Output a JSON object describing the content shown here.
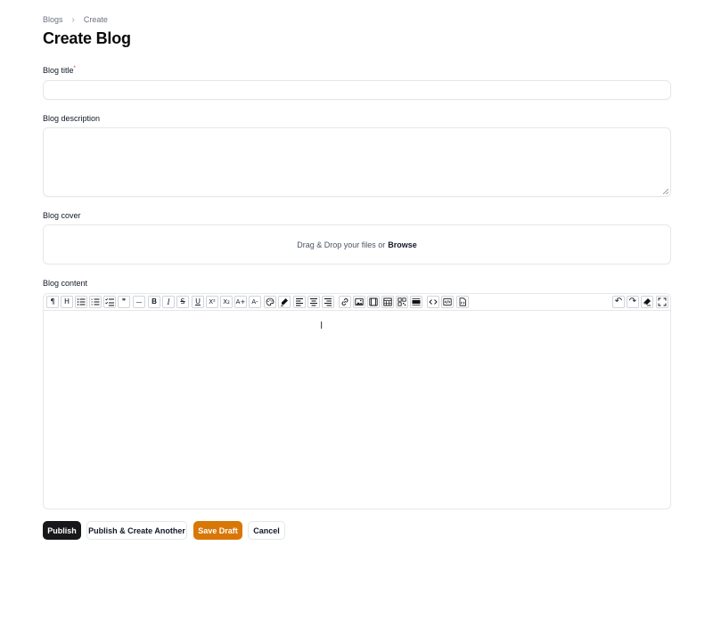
{
  "breadcrumb": {
    "parent": "Blogs",
    "separator": "›",
    "current": "Create"
  },
  "page_title": "Create Blog",
  "fields": {
    "title": {
      "label": "Blog title",
      "required_mark": "*",
      "value": ""
    },
    "description": {
      "label": "Blog description",
      "value": ""
    },
    "cover": {
      "label": "Blog cover",
      "drop_text": "Drag & Drop your files or",
      "browse_text": "Browse"
    },
    "content": {
      "label": "Blog content",
      "value": ""
    }
  },
  "toolbar": {
    "left": [
      {
        "name": "paragraph-icon",
        "glyph": "¶"
      },
      {
        "name": "heading-icon",
        "glyph": "H"
      },
      {
        "name": "bullet-list-icon",
        "glyph": ""
      },
      {
        "name": "ordered-list-icon",
        "glyph": ""
      },
      {
        "name": "checklist-icon",
        "glyph": ""
      },
      {
        "name": "blockquote-icon",
        "glyph": "❞"
      },
      {
        "name": "horizontal-rule-icon",
        "glyph": "—"
      },
      {
        "name": "bold-icon",
        "glyph": "B"
      },
      {
        "name": "italic-icon",
        "glyph": "I"
      },
      {
        "name": "strikethrough-icon",
        "glyph": "S"
      },
      {
        "name": "underline-icon",
        "glyph": "U"
      },
      {
        "name": "superscript-icon",
        "glyph": "X²"
      },
      {
        "name": "subscript-icon",
        "glyph": "X₂"
      },
      {
        "name": "font-size-increase-icon",
        "glyph": "A+"
      },
      {
        "name": "font-size-decrease-icon",
        "glyph": "A-"
      },
      {
        "name": "color-palette-icon",
        "glyph": ""
      },
      {
        "name": "highlighter-icon",
        "glyph": ""
      },
      {
        "name": "align-left-icon",
        "glyph": ""
      },
      {
        "name": "align-center-icon",
        "glyph": ""
      },
      {
        "name": "align-right-icon",
        "glyph": ""
      },
      {
        "name": "link-icon",
        "glyph": ""
      },
      {
        "name": "image-icon",
        "glyph": ""
      },
      {
        "name": "video-icon",
        "glyph": ""
      },
      {
        "name": "table-icon",
        "glyph": ""
      },
      {
        "name": "grid-icon",
        "glyph": ""
      },
      {
        "name": "block-icon",
        "glyph": ""
      },
      {
        "name": "code-icon",
        "glyph": ""
      },
      {
        "name": "code-block-icon",
        "glyph": ""
      },
      {
        "name": "source-file-icon",
        "glyph": ""
      }
    ],
    "right": [
      {
        "name": "undo-icon",
        "glyph": "↶"
      },
      {
        "name": "redo-icon",
        "glyph": "↷"
      },
      {
        "name": "clear-format-icon",
        "glyph": ""
      },
      {
        "name": "fullscreen-icon",
        "glyph": ""
      }
    ]
  },
  "actions": {
    "publish": "Publish",
    "publish_another": "Publish & Create Another",
    "save_draft": "Save Draft",
    "cancel": "Cancel"
  },
  "colors": {
    "primary": "#18181b",
    "draft": "#d97706",
    "border": "#e5e7eb",
    "required": "#dc2626"
  }
}
